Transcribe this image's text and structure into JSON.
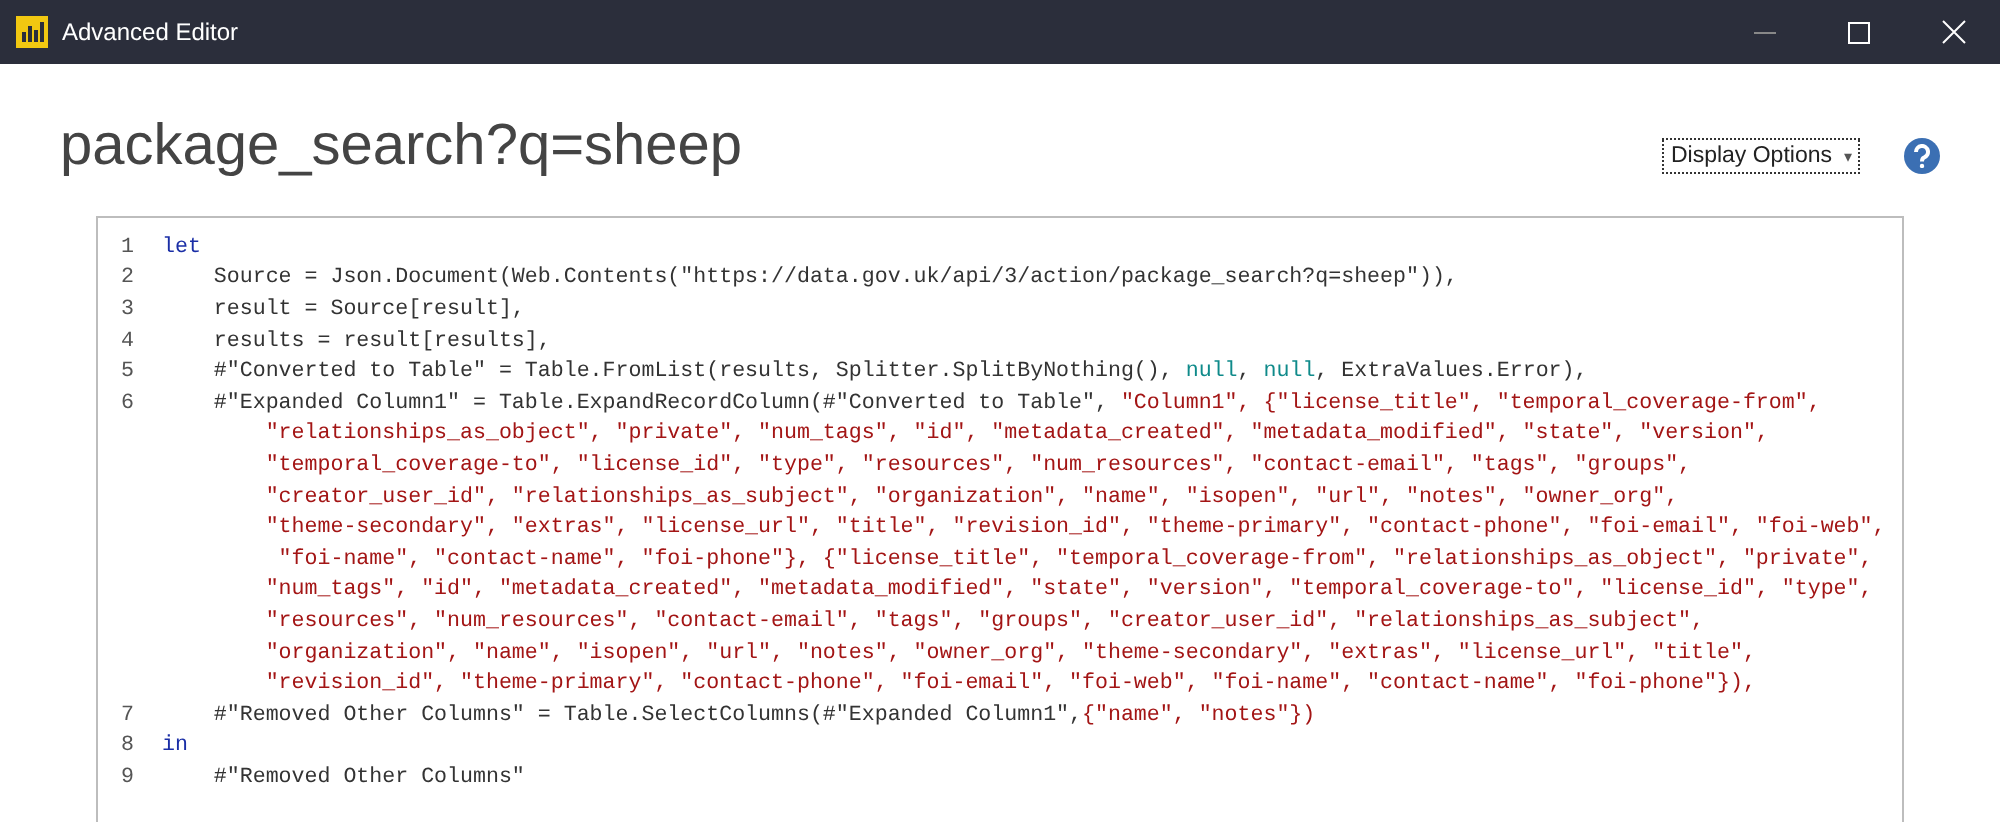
{
  "window": {
    "title": "Advanced Editor"
  },
  "query_title": "package_search?q=sheep",
  "display_options": {
    "label": "Display Options",
    "caret": "▾"
  },
  "editor": {
    "lines": [
      {
        "number": "1",
        "kind": "keyword",
        "parts": [
          {
            "kind": "keyword",
            "text": "let"
          }
        ]
      },
      {
        "number": "2",
        "kind": "statement",
        "parts": [
          {
            "kind": "plain",
            "text": "Source = Json.Document(Web.Contents(\"https://data.gov.uk/api/3/action/package_search?q=sheep\")),"
          }
        ]
      },
      {
        "number": "3",
        "kind": "statement",
        "parts": [
          {
            "kind": "plain",
            "text": "result = Source[result],"
          }
        ]
      },
      {
        "number": "4",
        "kind": "statement",
        "parts": [
          {
            "kind": "plain",
            "text": "results = result[results],"
          }
        ]
      },
      {
        "number": "5",
        "kind": "statement",
        "parts": [
          {
            "kind": "plain",
            "text": "#\"Converted to Table\" = Table.FromList(results, Splitter.SplitByNothing(), "
          },
          {
            "kind": "literal",
            "text": "null"
          },
          {
            "kind": "plain",
            "text": ", "
          },
          {
            "kind": "literal",
            "text": "null"
          },
          {
            "kind": "plain",
            "text": ", ExtraValues.Error),"
          }
        ]
      },
      {
        "number": "6",
        "kind": "statement",
        "parts": [
          {
            "kind": "plain",
            "text": "#\"Expanded Column1\" = Table.ExpandRecordColumn(#\"Converted to Table\", "
          },
          {
            "kind": "string",
            "text": "\"Column1\", {\"license_title\", \"temporal_coverage-from\","
          }
        ],
        "continuation": [
          "\"relationships_as_object\", \"private\", \"num_tags\", \"id\", \"metadata_created\", \"metadata_modified\", \"state\", \"version\",",
          "\"temporal_coverage-to\", \"license_id\", \"type\", \"resources\", \"num_resources\", \"contact-email\", \"tags\", \"groups\",",
          "\"creator_user_id\", \"relationships_as_subject\", \"organization\", \"name\", \"isopen\", \"url\", \"notes\", \"owner_org\",",
          "\"theme-secondary\", \"extras\", \"license_url\", \"title\", \"revision_id\", \"theme-primary\", \"contact-phone\", \"foi-email\", \"foi-web\",",
          " \"foi-name\", \"contact-name\", \"foi-phone\"}, {\"license_title\", \"temporal_coverage-from\", \"relationships_as_object\", \"private\",",
          "\"num_tags\", \"id\", \"metadata_created\", \"metadata_modified\", \"state\", \"version\", \"temporal_coverage-to\", \"license_id\", \"type\",",
          "\"resources\", \"num_resources\", \"contact-email\", \"tags\", \"groups\", \"creator_user_id\", \"relationships_as_subject\",",
          "\"organization\", \"name\", \"isopen\", \"url\", \"notes\", \"owner_org\", \"theme-secondary\", \"extras\", \"license_url\", \"title\",",
          "\"revision_id\", \"theme-primary\", \"contact-phone\", \"foi-email\", \"foi-web\", \"foi-name\", \"contact-name\", \"foi-phone\"}),"
        ]
      },
      {
        "number": "7",
        "kind": "statement",
        "parts": [
          {
            "kind": "plain",
            "text": "#\"Removed Other Columns\" = Table.SelectColumns(#\"Expanded Column1\","
          },
          {
            "kind": "string",
            "text": "{\"name\", \"notes\"})"
          }
        ]
      },
      {
        "number": "8",
        "kind": "keyword",
        "parts": [
          {
            "kind": "keyword",
            "text": "in"
          }
        ]
      },
      {
        "number": "9",
        "kind": "statement",
        "parts": [
          {
            "kind": "plain",
            "text": "#\"Removed Other Columns\""
          }
        ]
      }
    ]
  }
}
